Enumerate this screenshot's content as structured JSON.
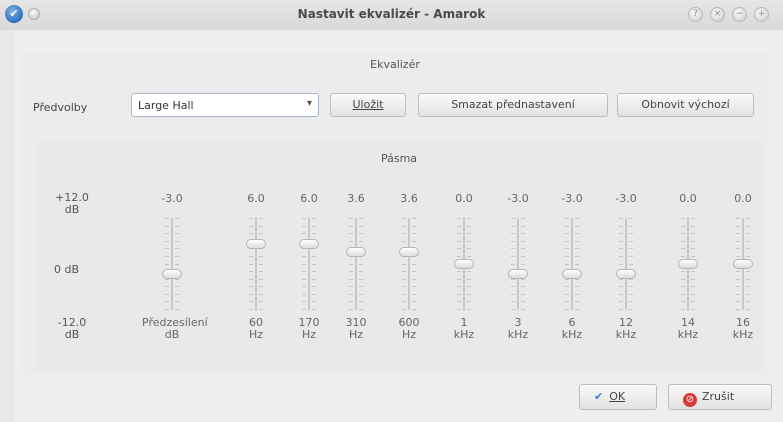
{
  "window": {
    "title": "Nastavit ekvalizér - Amarok",
    "app_icon": "amarok-icon",
    "titlebar_buttons": [
      "help-icon",
      "close-small-icon",
      "minimize-icon",
      "maximize-icon"
    ]
  },
  "equalizer": {
    "group_title": "Ekvalizér",
    "presets_label": "Předvolby",
    "preset_value": "Large Hall",
    "save_label": "Uložit",
    "delete_label": "Smazat přednastavení",
    "restore_label": "Obnovit výchozí"
  },
  "bands": {
    "group_title": "Pásma",
    "max_label_line1": "+12.0",
    "max_label_line2": "dB",
    "zero_label": "0 dB",
    "min_label_line1": "-12.0",
    "min_label_line2": "dB",
    "range_db": [
      -12,
      12
    ],
    "columns": [
      {
        "value": "-3.0",
        "db": -3.0,
        "name": "Předzesílení",
        "unit": "dB"
      },
      {
        "value": "6.0",
        "db": 6.0,
        "name": "60",
        "unit": "Hz"
      },
      {
        "value": "6.0",
        "db": 6.0,
        "name": "170",
        "unit": "Hz"
      },
      {
        "value": "3.6",
        "db": 3.6,
        "name": "310",
        "unit": "Hz"
      },
      {
        "value": "3.6",
        "db": 3.6,
        "name": "600",
        "unit": "Hz"
      },
      {
        "value": "0.0",
        "db": 0.0,
        "name": "1",
        "unit": "kHz"
      },
      {
        "value": "-3.0",
        "db": -3.0,
        "name": "3",
        "unit": "kHz"
      },
      {
        "value": "-3.0",
        "db": -3.0,
        "name": "6",
        "unit": "kHz"
      },
      {
        "value": "-3.0",
        "db": -3.0,
        "name": "12",
        "unit": "kHz"
      },
      {
        "value": "0.0",
        "db": 0.0,
        "name": "14",
        "unit": "kHz"
      },
      {
        "value": "0.0",
        "db": 0.0,
        "name": "16",
        "unit": "kHz"
      }
    ]
  },
  "dialog": {
    "ok_label": "OK",
    "cancel_label": "Zrušit"
  }
}
